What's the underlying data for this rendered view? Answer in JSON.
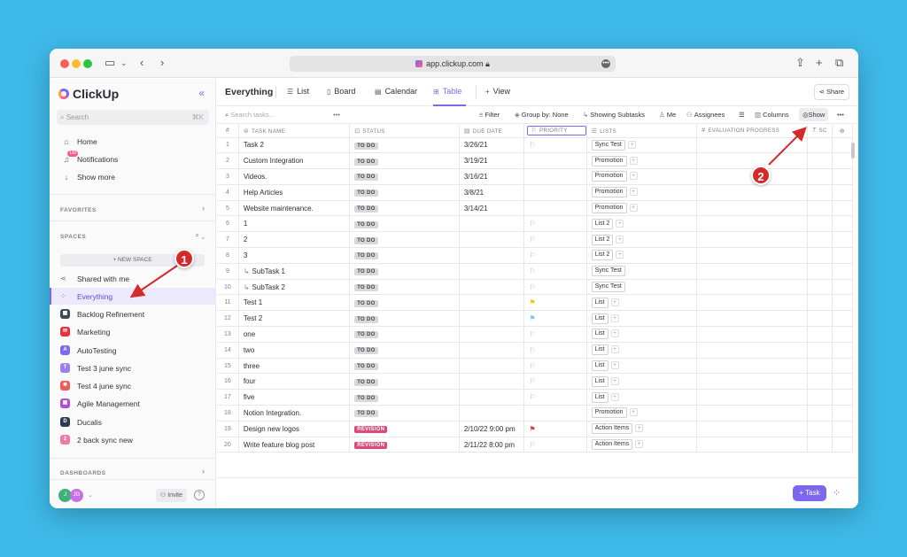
{
  "browser": {
    "url": "app.clickup.com"
  },
  "sidebar": {
    "brand": "ClickUp",
    "search_placeholder": "Search",
    "search_shortcut": "⌘K",
    "nav": [
      {
        "label": "Home",
        "icon": "home-icon"
      },
      {
        "label": "Notifications",
        "icon": "bell-icon",
        "badge": "130"
      },
      {
        "label": "Show more",
        "icon": "chevron-down-icon"
      }
    ],
    "favorites_label": "FAVORITES",
    "spaces_label": "SPACES",
    "new_space_label": "+ NEW SPACE",
    "spaces": [
      {
        "label": "Shared with me",
        "icon": "share-icon",
        "color": ""
      },
      {
        "label": "Everything",
        "icon": "grid-icon",
        "color": "",
        "active": true
      },
      {
        "label": "Backlog Refinement",
        "letter": "",
        "color": "#3b4a5a"
      },
      {
        "label": "Marketing",
        "letter": "",
        "color": "#e5323b"
      },
      {
        "label": "AutoTesting",
        "letter": "A",
        "color": "#7b68ee"
      },
      {
        "label": "Test 3 june sync",
        "letter": "T",
        "color": "#9b7ef0"
      },
      {
        "label": "Test 4 june sync",
        "letter": "",
        "color": "#ef5a5a"
      },
      {
        "label": "Agile Management",
        "letter": "",
        "color": "#b04fd6"
      },
      {
        "label": "Ducalis",
        "letter": "D",
        "color": "#2a3b4c"
      },
      {
        "label": "2 back sync new",
        "letter": "2",
        "color": "#f07aa6"
      }
    ],
    "dashboards_label": "DASHBOARDS",
    "avatars": [
      {
        "initials": "J",
        "color": "#3db37a"
      },
      {
        "initials": "JG",
        "color": "#c86fe4"
      }
    ],
    "invite_label": "Invite"
  },
  "main": {
    "title": "Everything",
    "tabs": [
      {
        "label": "List",
        "icon": "list-icon"
      },
      {
        "label": "Board",
        "icon": "board-icon"
      },
      {
        "label": "Calendar",
        "icon": "calendar-icon"
      },
      {
        "label": "Table",
        "icon": "table-icon",
        "active": true
      },
      {
        "label": "View",
        "icon": "plus-icon"
      }
    ],
    "share_label": "Share",
    "toolbar": {
      "search_placeholder": "Search tasks...",
      "filter": "Filter",
      "group_by": "Group by: None",
      "subtasks": "Showing Subtasks",
      "me": "Me",
      "assignees": "Assignees",
      "columns": "Columns",
      "show": "Show"
    },
    "columns": [
      "#",
      "TASK NAME",
      "STATUS",
      "DUE DATE",
      "PRIORITY",
      "LISTS",
      "EVALUATION PROGRESS",
      "SC"
    ],
    "rows": [
      {
        "n": "1",
        "name": "Task 2",
        "status": "TO DO",
        "due": "3/26/21",
        "flag": "gray",
        "list": "Sync Test",
        "plus": true,
        "sub": false
      },
      {
        "n": "2",
        "name": "Custom Integration",
        "status": "TO DO",
        "due": "3/19/21",
        "flag": "",
        "list": "Promotion",
        "plus": true,
        "sub": false
      },
      {
        "n": "3",
        "name": "Videos.",
        "status": "TO DO",
        "due": "3/16/21",
        "flag": "",
        "list": "Promotion",
        "plus": true,
        "sub": false
      },
      {
        "n": "4",
        "name": "Help Articles",
        "status": "TO DO",
        "due": "3/8/21",
        "flag": "",
        "list": "Promotion",
        "plus": true,
        "sub": false
      },
      {
        "n": "5",
        "name": "Website maintenance.",
        "status": "TO DO",
        "due": "3/14/21",
        "flag": "",
        "list": "Promotion",
        "plus": true,
        "sub": false
      },
      {
        "n": "6",
        "name": "1",
        "status": "TO DO",
        "due": "",
        "flag": "gray",
        "list": "List 2",
        "plus": true,
        "sub": false
      },
      {
        "n": "7",
        "name": "2",
        "status": "TO DO",
        "due": "",
        "flag": "gray",
        "list": "List 2",
        "plus": true,
        "sub": false
      },
      {
        "n": "8",
        "name": "3",
        "status": "TO DO",
        "due": "",
        "flag": "gray",
        "list": "List 2",
        "plus": true,
        "sub": false
      },
      {
        "n": "9",
        "name": "SubTask 1",
        "status": "TO DO",
        "due": "",
        "flag": "gray",
        "list": "Sync Test",
        "plus": false,
        "sub": true
      },
      {
        "n": "10",
        "name": "SubTask 2",
        "status": "TO DO",
        "due": "",
        "flag": "gray",
        "list": "Sync Test",
        "plus": false,
        "sub": true
      },
      {
        "n": "11",
        "name": "Test 1",
        "status": "TO DO",
        "due": "",
        "flag": "yellow",
        "list": "List",
        "plus": true,
        "sub": false
      },
      {
        "n": "12",
        "name": "Test 2",
        "status": "TO DO",
        "due": "",
        "flag": "blue",
        "list": "List",
        "plus": true,
        "sub": false
      },
      {
        "n": "13",
        "name": "one",
        "status": "TO DO",
        "due": "",
        "flag": "gray",
        "list": "List",
        "plus": true,
        "sub": false
      },
      {
        "n": "14",
        "name": "two",
        "status": "TO DO",
        "due": "",
        "flag": "gray",
        "list": "List",
        "plus": true,
        "sub": false
      },
      {
        "n": "15",
        "name": "three",
        "status": "TO DO",
        "due": "",
        "flag": "gray",
        "list": "List",
        "plus": true,
        "sub": false
      },
      {
        "n": "16",
        "name": "four",
        "status": "TO DO",
        "due": "",
        "flag": "gray",
        "list": "List",
        "plus": true,
        "sub": false
      },
      {
        "n": "17",
        "name": "five",
        "status": "TO DO",
        "due": "",
        "flag": "gray",
        "list": "List",
        "plus": true,
        "sub": false
      },
      {
        "n": "18",
        "name": "Notion Integration.",
        "status": "TO DO",
        "due": "",
        "flag": "",
        "list": "Promotion",
        "plus": true,
        "sub": false
      },
      {
        "n": "19",
        "name": "Design new logos",
        "status": "REVISION",
        "due": "2/10/22 9:00 pm",
        "flag": "red",
        "list": "Action Items",
        "plus": true,
        "sub": false
      },
      {
        "n": "20",
        "name": "Write feature blog post",
        "status": "REVISION",
        "due": "2/11/22 8:00 pm",
        "flag": "gray",
        "list": "Action Items",
        "plus": true,
        "sub": false
      }
    ],
    "add_task_label": "+ Task"
  },
  "annotations": [
    {
      "label": "1",
      "color": "#d42a2a"
    },
    {
      "label": "2",
      "color": "#d42a2a"
    }
  ]
}
